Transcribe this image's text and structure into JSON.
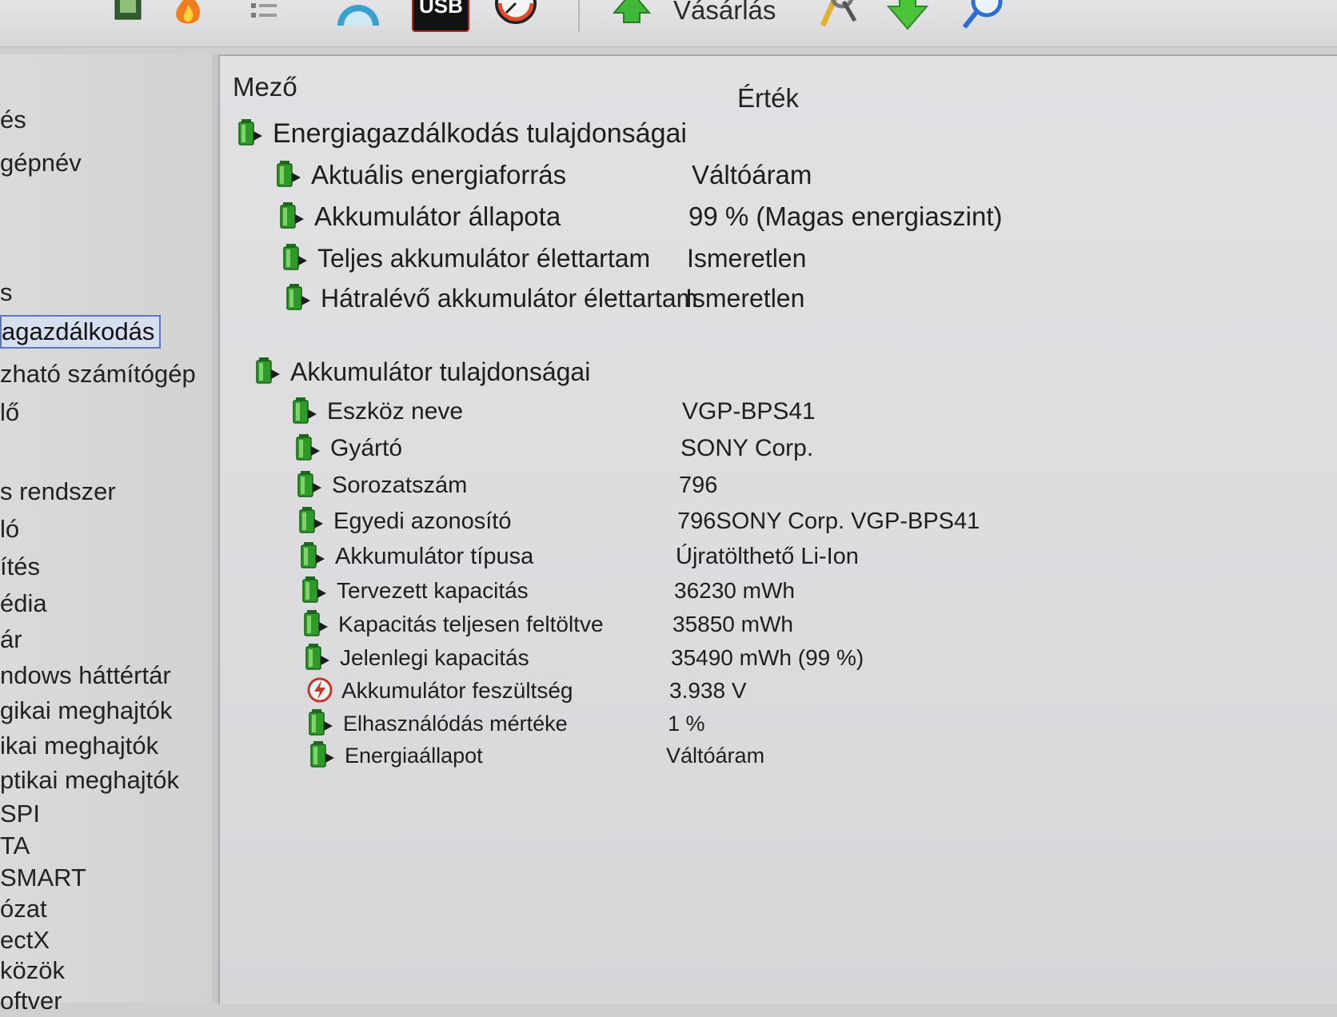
{
  "toolbar": {
    "buy_label": "Vásárlás",
    "usb_badge": "USB",
    "icons": [
      "chip-icon",
      "fire-icon",
      "list-icon",
      "gauge-icon",
      "usb-icon",
      "benchmark-icon",
      "buy-arrow-icon",
      "tools-icon",
      "download-icon",
      "search-icon"
    ]
  },
  "sidebar": {
    "items": [
      {
        "label": "és"
      },
      {
        "label": "gépnév"
      },
      {
        "label": "s"
      },
      {
        "label": "agazdálkodás",
        "selected": true
      },
      {
        "label": "zható számítógép"
      },
      {
        "label": "lő"
      },
      {
        "label": "s rendszer"
      },
      {
        "label": "ló"
      },
      {
        "label": "ítés"
      },
      {
        "label": "édia"
      },
      {
        "label": "ár"
      },
      {
        "label": "ndows háttértár"
      },
      {
        "label": "gikai meghajtók"
      },
      {
        "label": "ikai meghajtók"
      },
      {
        "label": "ptikai meghajtók"
      },
      {
        "label": "SPI"
      },
      {
        "label": "TA"
      },
      {
        "label": "SMART"
      },
      {
        "label": "ózat"
      },
      {
        "label": "ectX"
      },
      {
        "label": "közök"
      },
      {
        "label": "oftver"
      }
    ]
  },
  "table": {
    "col_field": "Mező",
    "col_value": "Érték",
    "groups": [
      {
        "title": "Energiagazdálkodás tulajdonságai",
        "rows": [
          {
            "field": "Aktuális energiaforrás",
            "value": "Váltóáram"
          },
          {
            "field": "Akkumulátor állapota",
            "value": "99 % (Magas energiaszint)"
          },
          {
            "field": "Teljes akkumulátor élettartam",
            "value": "Ismeretlen"
          },
          {
            "field": "Hátralévő akkumulátor élettartam",
            "value": "Ismeretlen"
          }
        ]
      },
      {
        "title": "Akkumulátor tulajdonságai",
        "rows": [
          {
            "field": "Eszköz neve",
            "value": "VGP-BPS41"
          },
          {
            "field": "Gyártó",
            "value": "SONY Corp."
          },
          {
            "field": "Sorozatszám",
            "value": "796"
          },
          {
            "field": "Egyedi azonosító",
            "value": "796SONY Corp. VGP-BPS41"
          },
          {
            "field": "Akkumulátor típusa",
            "value": "Újratölthető Li-Ion"
          },
          {
            "field": "Tervezett kapacitás",
            "value": "36230 mWh"
          },
          {
            "field": "Kapacitás teljesen feltöltve",
            "value": "35850 mWh"
          },
          {
            "field": "Jelenlegi kapacitás",
            "value": "35490 mWh  (99 %)"
          },
          {
            "field": "Akkumulátor feszültség",
            "value": "3.938 V",
            "icon": "lightning-icon"
          },
          {
            "field": "Elhasználódás mértéke",
            "value": "1 %"
          },
          {
            "field": "Energiaállapot",
            "value": "Váltóáram"
          }
        ]
      }
    ]
  },
  "colors": {
    "battery_green": "#2e9a2a",
    "selection_border": "#5c78b8",
    "lightning_red": "#c0392b"
  }
}
